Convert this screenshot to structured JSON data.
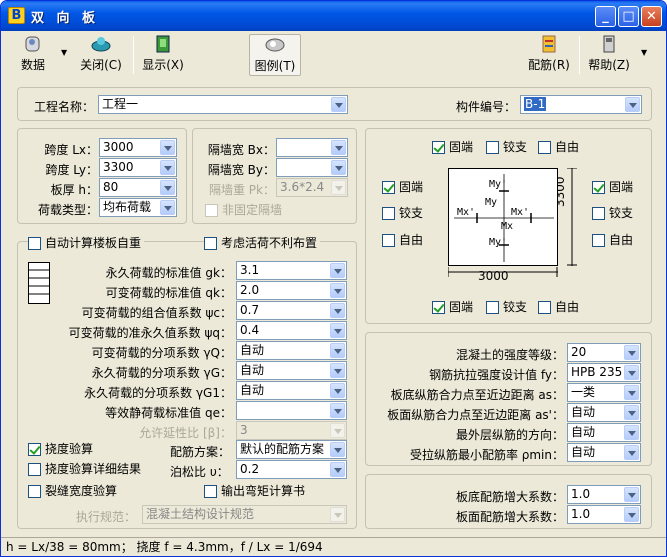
{
  "window": {
    "title": "双 向 板",
    "icon_letter": "B"
  },
  "toolbar": {
    "data": "数据",
    "close": "关闭(C)",
    "display": "显示(X)",
    "legend": "图例(T)",
    "rebar": "配筋(R)",
    "help": "帮助(Z)"
  },
  "project": {
    "name_label": "工程名称：",
    "name_value": "工程一",
    "id_label": "构件编号：",
    "id_value": "B-1"
  },
  "geometry": {
    "lx_label": "跨度 Lx：",
    "lx_value": "3000",
    "ly_label": "跨度 Ly：",
    "ly_value": "3300",
    "h_label": "板厚 h：",
    "h_value": "80",
    "load_type_label": "荷载类型：",
    "load_type_value": "均布荷载"
  },
  "wall": {
    "bx_label": "隔墙宽 Bx：",
    "bx_value": "",
    "by_label": "隔墙宽 By：",
    "by_value": "",
    "pk_label": "隔墙重 Pk：",
    "pk_value": "3.6*2.4",
    "nonfixed_label": "非固定隔墙"
  },
  "boundary": {
    "top": {
      "fixed": "固端",
      "hinged": "铰支",
      "free": "自由"
    },
    "left": {
      "fixed": "固端",
      "hinged": "铰支",
      "free": "自由"
    },
    "right": {
      "fixed": "固端",
      "hinged": "铰支",
      "free": "自由"
    },
    "bottom": {
      "fixed": "固端",
      "hinged": "铰支",
      "free": "自由"
    },
    "dim_x": "3000",
    "dim_y": "3300",
    "labels": {
      "my_top": "My'",
      "my": "My",
      "mx_left": "Mx'",
      "mx_right": "Mx'",
      "mx": "Mx",
      "my_bottom": "My'"
    }
  },
  "loads": {
    "auto_self_weight": "自动计算楼板自重",
    "live_unfavorable": "考虑活荷不利布置",
    "gk_label": "永久荷载的标准值 gk：",
    "gk_value": "3.1",
    "qk_label": "可变荷载的标准值 qk：",
    "qk_value": "2.0",
    "psic_label": "可变荷载的组合值系数 ψc：",
    "psic_value": "0.7",
    "psiq_label": "可变荷载的准永久值系数 ψq：",
    "psiq_value": "0.4",
    "gq_label": "可变荷载的分项系数 γQ：",
    "gq_value": "自动",
    "gg_label": "永久荷载的分项系数 γG：",
    "gg_value": "自动",
    "gg1_label": "永久荷载的分项系数 γG1：",
    "gg1_value": "自动",
    "qe_label": "等效静荷载标准值 qe：",
    "qe_value": "",
    "beta_label": "允许延性比 [β]：",
    "beta_value": "3"
  },
  "checks": {
    "deflection": "挠度验算",
    "deflection_detail": "挠度验算详细结果",
    "crack": "裂缝宽度验算",
    "output_moment": "输出弯矩计算书",
    "scheme_label": "配筋方案：",
    "scheme_value": "默认的配筋方案",
    "poisson_label": "泊松比 υ：",
    "poisson_value": "0.2",
    "code_label": "执行规范：",
    "code_value": "混凝土结构设计规范"
  },
  "materials": {
    "concrete_label": "混凝土的强度等级：",
    "concrete_value": "20",
    "fy_label": "钢筋抗拉强度设计值 fy：",
    "fy_value": "HPB 235",
    "as_label": "板底纵筋合力点至近边距离 as：",
    "as_value": "一类",
    "as2_label": "板面纵筋合力点至近边距离 as'：",
    "as2_value": "自动",
    "dir_label": "最外层纵筋的方向：",
    "dir_value": "自动",
    "rho_label": "受拉纵筋最小配筋率 ρmin：",
    "rho_value": "自动"
  },
  "amplify": {
    "bottom_label": "板底配筋增大系数：",
    "bottom_value": "1.0",
    "top_label": "板面配筋增大系数：",
    "top_value": "1.0"
  },
  "status": {
    "text": "h = Lx/38 = 80mm； 挠度 f = 4.3mm，f / Lx = 1/694"
  }
}
